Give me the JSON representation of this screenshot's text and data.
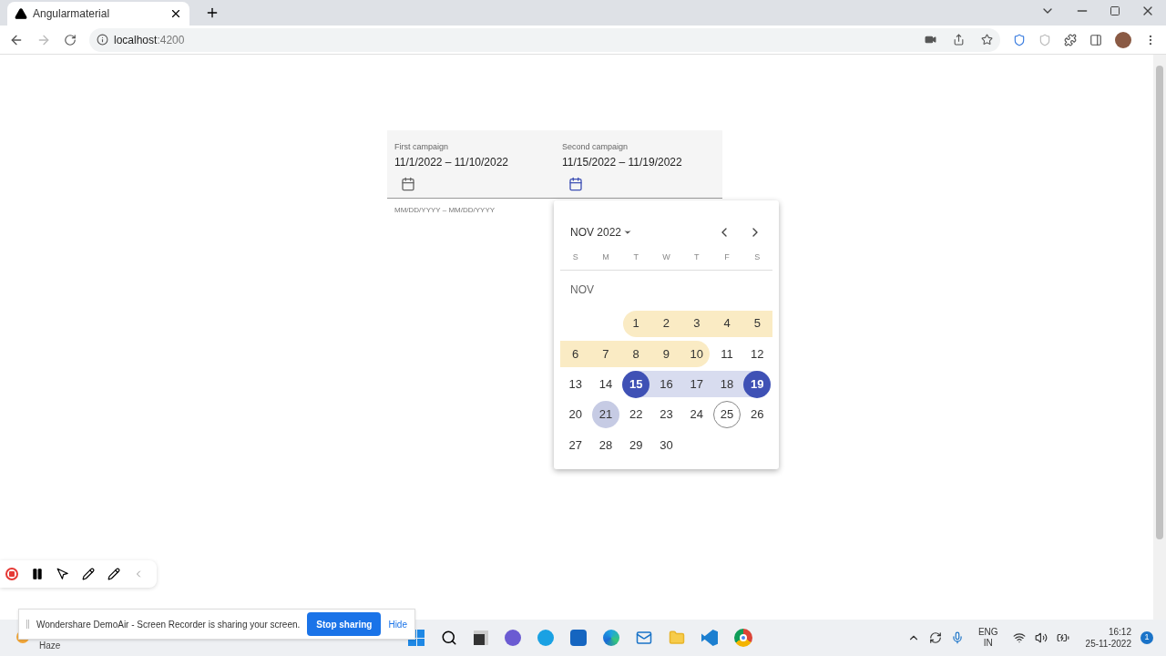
{
  "browser": {
    "tab_title": "Angularmaterial",
    "url_host": "localhost",
    "url_port": ":4200"
  },
  "fields": [
    {
      "label": "First campaign",
      "value": "11/1/2022 – 11/10/2022",
      "focused": false
    },
    {
      "label": "Second campaign",
      "value": "11/15/2022 – 11/19/2022",
      "focused": true
    }
  ],
  "hint": "MM/DD/YYYY – MM/DD/YYYY",
  "calendar": {
    "period": "NOV 2022",
    "weekdays": [
      "S",
      "M",
      "T",
      "W",
      "T",
      "F",
      "S"
    ],
    "month_label": "NOV",
    "weeks": [
      {
        "days": [
          {
            "day": "1",
            "color": "#faebc4",
            "selected": false,
            "today": false,
            "hovered": false
          },
          {
            "day": "2",
            "color": "#faebc4",
            "selected": false,
            "today": false,
            "hovered": false
          },
          {
            "day": "3",
            "color": "#faebc4",
            "selected": false,
            "today": false,
            "hovered": false
          },
          {
            "day": "4",
            "color": "#faebc4",
            "selected": false,
            "today": false,
            "hovered": false
          },
          {
            "day": "5",
            "color": "#faebc4",
            "selected": false,
            "today": false,
            "hovered": false
          }
        ]
      },
      {
        "days": [
          {
            "day": "6",
            "color": "#faebc4",
            "selected": false,
            "today": false,
            "hovered": false
          },
          {
            "day": "7",
            "color": "#faebc4",
            "selected": false,
            "today": false,
            "hovered": false
          },
          {
            "day": "8",
            "color": "#faebc4",
            "selected": false,
            "today": false,
            "hovered": false
          },
          {
            "day": "9",
            "color": "#faebc4",
            "selected": false,
            "today": false,
            "hovered": false
          },
          {
            "day": "10",
            "color": "#faebc4",
            "selected": false,
            "today": false,
            "hovered": false
          },
          {
            "day": "11",
            "selected": false,
            "today": false,
            "hovered": false
          },
          {
            "day": "12",
            "selected": false,
            "today": false,
            "hovered": false
          }
        ]
      },
      {
        "days": [
          {
            "day": "13",
            "selected": false,
            "today": false,
            "hovered": false
          },
          {
            "day": "14",
            "selected": false,
            "today": false,
            "hovered": false
          },
          {
            "day": "15",
            "color": "#d8dcef",
            "selected": true,
            "today": false,
            "hovered": false
          },
          {
            "day": "16",
            "color": "#d8dcef",
            "selected": false,
            "today": false,
            "hovered": false
          },
          {
            "day": "17",
            "color": "#d8dcef",
            "selected": false,
            "today": false,
            "hovered": false
          },
          {
            "day": "18",
            "color": "#d8dcef",
            "selected": false,
            "today": false,
            "hovered": false
          },
          {
            "day": "19",
            "color": "#d8dcef",
            "selected": true,
            "today": false,
            "hovered": false
          }
        ]
      },
      {
        "days": [
          {
            "day": "20",
            "selected": false,
            "today": false,
            "hovered": false
          },
          {
            "day": "21",
            "selected": false,
            "today": false,
            "hovered": true
          },
          {
            "day": "22",
            "selected": false,
            "today": false,
            "hovered": false
          },
          {
            "day": "23",
            "selected": false,
            "today": false,
            "hovered": false
          },
          {
            "day": "24",
            "selected": false,
            "today": false,
            "hovered": false
          },
          {
            "day": "25",
            "selected": false,
            "today": true,
            "hovered": false
          },
          {
            "day": "26",
            "selected": false,
            "today": false,
            "hovered": false
          }
        ]
      },
      {
        "days": [
          {
            "day": "27",
            "selected": false,
            "today": false,
            "hovered": false
          },
          {
            "day": "28",
            "selected": false,
            "today": false,
            "hovered": false
          },
          {
            "day": "29",
            "selected": false,
            "today": false,
            "hovered": false
          },
          {
            "day": "30",
            "selected": false,
            "today": false,
            "hovered": false
          }
        ]
      }
    ]
  },
  "sharing_bar": {
    "message": "Wondershare DemoAir - Screen Recorder is sharing your screen.",
    "stop_button": "Stop sharing",
    "hide_link": "Hide"
  },
  "taskbar": {
    "weather": "Haze",
    "language": "ENG",
    "region": "IN",
    "time": "16:12",
    "date": "25-11-2022",
    "notification_count": "1"
  }
}
